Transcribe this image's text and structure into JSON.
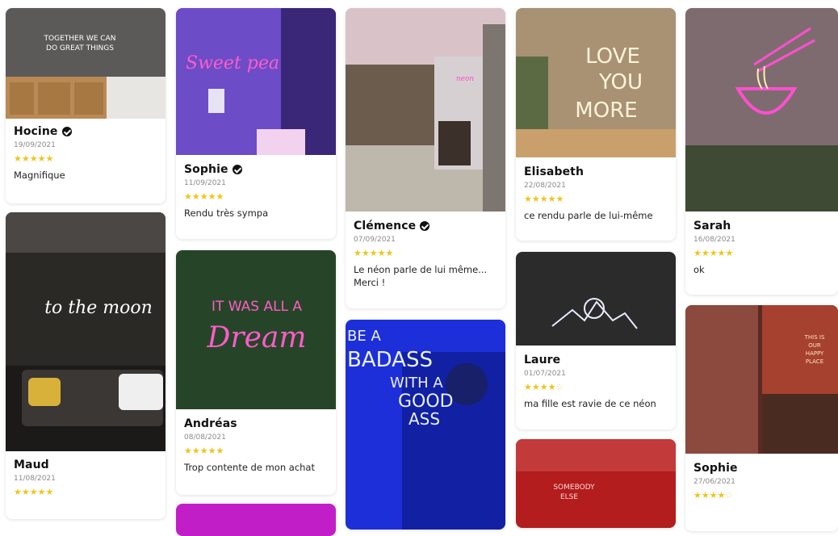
{
  "accent_star_color": "#f0c419",
  "reviews": [
    {
      "name": "Hocine",
      "verified": true,
      "date": "19/09/2021",
      "rating": 5,
      "text": "Magnifique",
      "neon_text": "TOGETHER WE CAN\nDO GREAT THINGS"
    },
    {
      "name": "Maud",
      "verified": false,
      "date": "11/08/2021",
      "rating": 5,
      "text": "",
      "neon_text": "to the moon"
    },
    {
      "name": "Sophie",
      "verified": true,
      "date": "11/09/2021",
      "rating": 5,
      "text": "Rendu très sympa",
      "neon_text": "Sweet pea"
    },
    {
      "name": "Andréas",
      "verified": false,
      "date": "08/08/2021",
      "rating": 5,
      "text": "Trop contente de mon achat",
      "neon_text": "IT WAS ALL A Dream"
    },
    {
      "name": "Clémence",
      "verified": true,
      "date": "07/09/2021",
      "rating": 5,
      "text": "Le néon parle de lui même... Merci !",
      "neon_text": ""
    },
    {
      "name": "",
      "verified": false,
      "date": "",
      "rating": 0,
      "text": "",
      "neon_text": "BE A BADASS WITH A GOOD ASS"
    },
    {
      "name": "Elisabeth",
      "verified": false,
      "date": "22/08/2021",
      "rating": 5,
      "text": "ce rendu parle de lui-même",
      "neon_text": "LOVE YOU MORE"
    },
    {
      "name": "Laure",
      "verified": false,
      "date": "01/07/2021",
      "rating": 4,
      "text": "ma fille est ravie de ce néon",
      "neon_text": ""
    },
    {
      "name": "",
      "verified": false,
      "date": "",
      "rating": 0,
      "text": "",
      "neon_text": "SOMEBODY ELSE"
    },
    {
      "name": "Sarah",
      "verified": false,
      "date": "16/08/2021",
      "rating": 5,
      "text": "ok",
      "neon_text": ""
    },
    {
      "name": "Sophie",
      "verified": false,
      "date": "27/06/2021",
      "rating": 4,
      "text": "",
      "neon_text": "THIS IS OUR HAPPY PLACE"
    }
  ],
  "star_glyphs": {
    "full": "★★★★★",
    "four": "★★★★"
  }
}
